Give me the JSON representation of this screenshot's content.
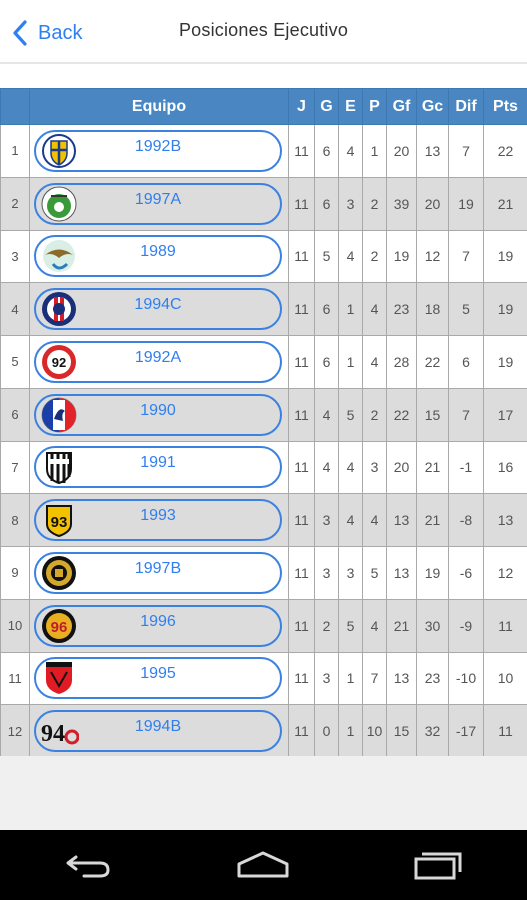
{
  "header": {
    "back_label": "Back",
    "title": "Posiciones Ejecutivo"
  },
  "table": {
    "columns": [
      "",
      "Equipo",
      "J",
      "G",
      "E",
      "P",
      "Gf",
      "Gc",
      "Dif",
      "Pts"
    ],
    "rows": [
      {
        "pos": "1",
        "team": "1992B",
        "j": "11",
        "g": "6",
        "e": "4",
        "p": "1",
        "gf": "20",
        "gc": "13",
        "dif": "7",
        "pts": "22",
        "logo": "crest-shield-logo"
      },
      {
        "pos": "2",
        "team": "1997A",
        "j": "11",
        "g": "6",
        "e": "3",
        "p": "2",
        "gf": "39",
        "gc": "20",
        "dif": "19",
        "pts": "21",
        "logo": "green-circle-logo"
      },
      {
        "pos": "3",
        "team": "1989",
        "j": "11",
        "g": "5",
        "e": "4",
        "p": "2",
        "gf": "19",
        "gc": "12",
        "dif": "7",
        "pts": "19",
        "logo": "eagle-logo"
      },
      {
        "pos": "4",
        "team": "1994C",
        "j": "11",
        "g": "6",
        "e": "1",
        "p": "4",
        "gf": "23",
        "gc": "18",
        "dif": "5",
        "pts": "19",
        "logo": "psg-style-logo"
      },
      {
        "pos": "5",
        "team": "1992A",
        "j": "11",
        "g": "6",
        "e": "1",
        "p": "4",
        "gf": "28",
        "gc": "22",
        "dif": "6",
        "pts": "19",
        "logo": "red-92-logo"
      },
      {
        "pos": "6",
        "team": "1990",
        "j": "11",
        "g": "4",
        "e": "5",
        "p": "2",
        "gf": "22",
        "gc": "15",
        "dif": "7",
        "pts": "17",
        "logo": "tricolor-rooster-logo"
      },
      {
        "pos": "7",
        "team": "1991",
        "j": "11",
        "g": "4",
        "e": "4",
        "p": "3",
        "gf": "20",
        "gc": "21",
        "dif": "-1",
        "pts": "16",
        "logo": "striped-shield-logo"
      },
      {
        "pos": "8",
        "team": "1993",
        "j": "11",
        "g": "3",
        "e": "4",
        "p": "4",
        "gf": "13",
        "gc": "21",
        "dif": "-8",
        "pts": "13",
        "logo": "yellow-93-logo"
      },
      {
        "pos": "9",
        "team": "1997B",
        "j": "11",
        "g": "3",
        "e": "3",
        "p": "5",
        "gf": "13",
        "gc": "19",
        "dif": "-6",
        "pts": "12",
        "logo": "black-gold-crest-logo"
      },
      {
        "pos": "10",
        "team": "1996",
        "j": "11",
        "g": "2",
        "e": "5",
        "p": "4",
        "gf": "21",
        "gc": "30",
        "dif": "-9",
        "pts": "11",
        "logo": "black-96-logo"
      },
      {
        "pos": "11",
        "team": "1995",
        "j": "11",
        "g": "3",
        "e": "1",
        "p": "7",
        "gf": "13",
        "gc": "23",
        "dif": "-10",
        "pts": "10",
        "logo": "red-shield-logo"
      },
      {
        "pos": "12",
        "team": "1994B",
        "j": "11",
        "g": "0",
        "e": "1",
        "p": "10",
        "gf": "15",
        "gc": "32",
        "dif": "-17",
        "pts": "11",
        "logo": "94b-logo"
      }
    ]
  },
  "navbar": {
    "icons": [
      "back-nav-icon",
      "home-nav-icon",
      "recents-nav-icon"
    ]
  },
  "colors": {
    "accent": "#2f7ff0",
    "header_bg": "#4a87c2",
    "row_alt": "#dcdcdc"
  }
}
